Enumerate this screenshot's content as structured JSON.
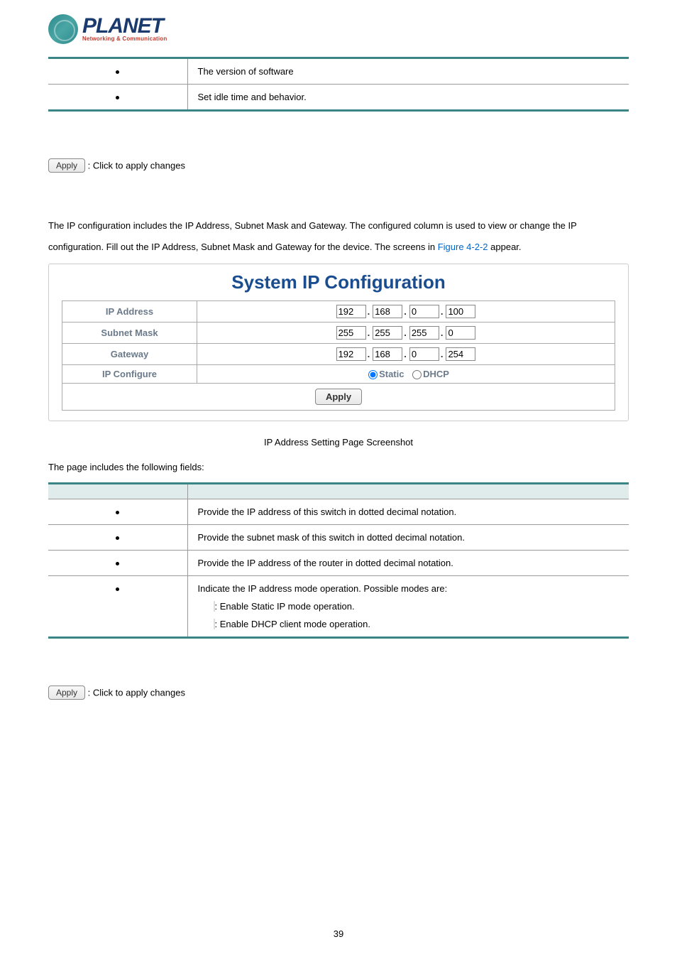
{
  "logo": {
    "brand": "PLANET",
    "tagline": "Networking & Communication"
  },
  "table1": {
    "rows": [
      {
        "desc": "The version of software"
      },
      {
        "desc": "Set idle time and behavior."
      }
    ]
  },
  "applyBtn": "Apply",
  "applyText": ": Click to apply changes",
  "intro": {
    "part1": "The IP configuration includes the IP Address, Subnet Mask and Gateway. The configured column is used to view or change the IP configuration. Fill out the IP Address, Subnet Mask and Gateway for the device. The screens in ",
    "link": "Figure 4-2-2",
    "part2": " appear."
  },
  "ipConfig": {
    "title": "System IP Configuration",
    "rows": {
      "ipAddress": {
        "label": "IP Address",
        "o1": "192",
        "o2": "168",
        "o3": "0",
        "o4": "100"
      },
      "subnet": {
        "label": "Subnet Mask",
        "o1": "255",
        "o2": "255",
        "o3": "255",
        "o4": "0"
      },
      "gateway": {
        "label": "Gateway",
        "o1": "192",
        "o2": "168",
        "o3": "0",
        "o4": "254"
      },
      "ipconf": {
        "label": "IP Configure",
        "opt1": "Static",
        "opt2": "DHCP"
      }
    },
    "apply": "Apply"
  },
  "caption": " IP Address Setting Page Screenshot",
  "fieldsIntro": "The page includes the following fields:",
  "table2": {
    "rows": [
      {
        "desc": "Provide the IP address of this switch in dotted decimal notation."
      },
      {
        "desc": "Provide the subnet mask of this switch in dotted decimal notation."
      },
      {
        "desc": "Provide the IP address of the router in dotted decimal notation."
      },
      {
        "desc": "Indicate the IP address mode operation. Possible modes are:",
        "modes": [
          {
            "label": "",
            "text": ": Enable Static IP mode operation."
          },
          {
            "label": "",
            "text": ": Enable DHCP client mode operation."
          }
        ]
      }
    ]
  },
  "pageNum": "39"
}
